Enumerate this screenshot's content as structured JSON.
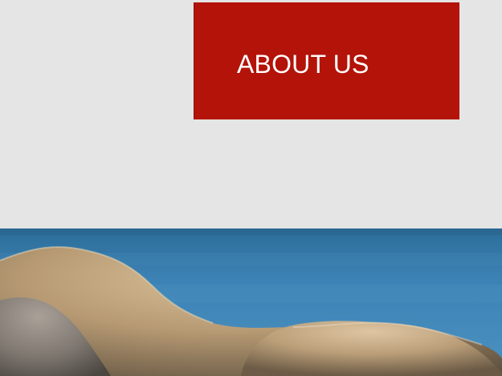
{
  "nav": {
    "about_tile": {
      "label": "ABOUT US",
      "background": "#b31308",
      "text_color": "#ffffff"
    }
  },
  "hero": {
    "image_alt": "coastal-rocks-photo"
  },
  "theme": {
    "page_background": "#e5e5e5",
    "sea": "#3b78a8",
    "rock": "#b59b78"
  }
}
